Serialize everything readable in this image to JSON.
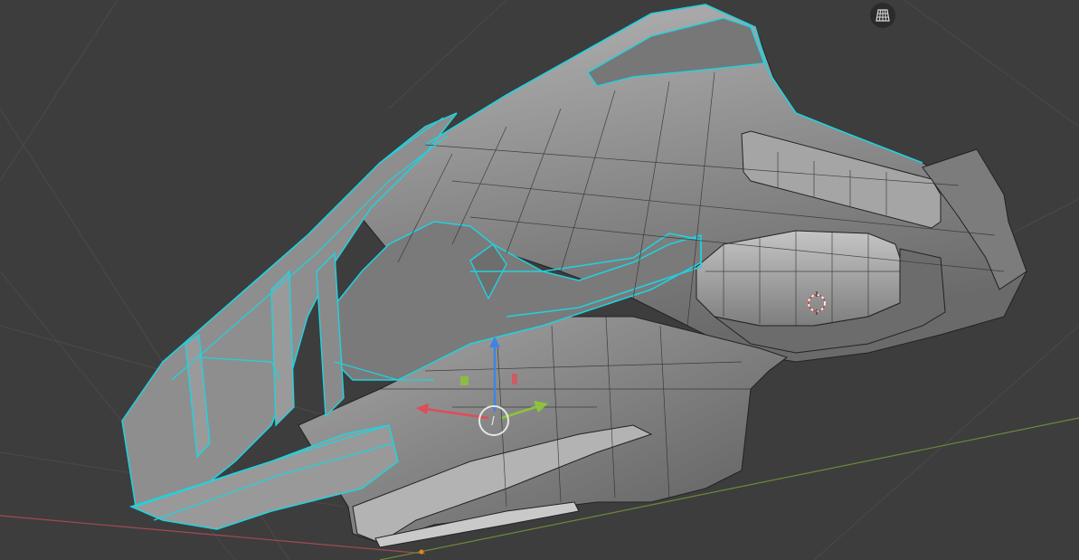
{
  "app": {
    "mode": "edit-mode",
    "theme": {
      "viewport_bg": "#3d3d3d",
      "grid_line": "#4a4a4a",
      "x_axis": "#a34a55",
      "y_axis": "#6b8a3a",
      "mesh_fill": "#8c8c8c",
      "mesh_wire": "#1e1e1e",
      "selection": "#1fd3e0"
    }
  },
  "viewport": {
    "overlay_buttons": [
      {
        "icon": "perspective-grid-icon",
        "tooltip": ""
      }
    ],
    "gizmo": {
      "type": "move",
      "axes": [
        "x",
        "y",
        "z"
      ],
      "colors": {
        "x": "#e04c59",
        "y": "#8bc43a",
        "z": "#3f84e3"
      }
    },
    "cursor_3d": {
      "visible": true
    }
  }
}
